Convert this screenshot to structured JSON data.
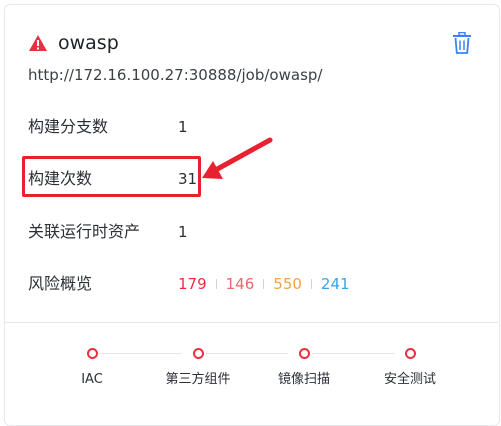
{
  "card": {
    "title": "owasp",
    "url": "http://172.16.100.27:30888/job/owasp/",
    "rows": [
      {
        "label": "构建分支数",
        "value": "1"
      },
      {
        "label": "构建次数",
        "value": "31"
      },
      {
        "label": "关联运行时资产",
        "value": "1"
      }
    ],
    "risk": {
      "label": "风险概览",
      "values": [
        "179",
        "146",
        "550",
        "241"
      ]
    },
    "steps": [
      "IAC",
      "第三方组件",
      "镜像扫描",
      "安全测试"
    ]
  },
  "icons": {
    "warning": "warning-triangle-icon",
    "delete": "trash-icon"
  },
  "colors": {
    "warning": "#e8313f",
    "delete": "#3b82f6",
    "risk_critical": "#e8313f",
    "risk_high": "#f0656b",
    "risk_medium": "#f5a04a",
    "risk_low": "#3aa3e8",
    "annotation": "#e8212e",
    "step_dot": "#e8313f"
  }
}
